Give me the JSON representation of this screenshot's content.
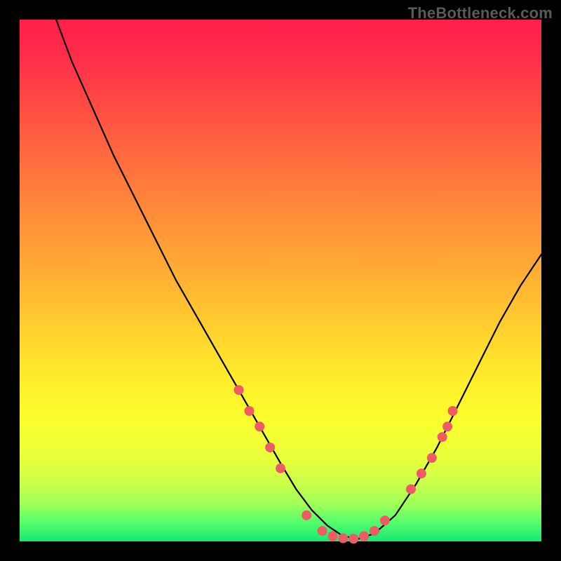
{
  "watermark": "TheBottleneck.com",
  "colors": {
    "background": "#000000",
    "curve": "#000000",
    "dots": "#ef5b63",
    "gradient_top": "#ff1f4b",
    "gradient_bottom": "#17e874"
  },
  "chart_data": {
    "type": "line",
    "title": "",
    "xlabel": "",
    "ylabel": "",
    "xlim": [
      0,
      100
    ],
    "ylim": [
      0,
      100
    ],
    "grid": false,
    "legend": false,
    "annotations": [],
    "series": [
      {
        "name": "curve",
        "x": [
          7,
          10,
          14,
          18,
          22,
          26,
          30,
          34,
          38,
          42,
          46,
          50,
          53,
          56,
          59,
          62,
          65,
          68,
          72,
          76,
          80,
          84,
          88,
          92,
          96,
          100
        ],
        "y": [
          100,
          92,
          83,
          74,
          66,
          58,
          50,
          43,
          36,
          29,
          22,
          15,
          10,
          6,
          3,
          1,
          0.5,
          1.5,
          5,
          11,
          18,
          26,
          34,
          42,
          49,
          55
        ]
      }
    ],
    "markers": [
      {
        "x": 42,
        "y": 29
      },
      {
        "x": 44,
        "y": 25
      },
      {
        "x": 46,
        "y": 22
      },
      {
        "x": 48,
        "y": 18
      },
      {
        "x": 50,
        "y": 14
      },
      {
        "x": 55,
        "y": 5
      },
      {
        "x": 58,
        "y": 2
      },
      {
        "x": 60,
        "y": 1
      },
      {
        "x": 62,
        "y": 0.6
      },
      {
        "x": 64,
        "y": 0.5
      },
      {
        "x": 66,
        "y": 1
      },
      {
        "x": 68,
        "y": 2
      },
      {
        "x": 70,
        "y": 4
      },
      {
        "x": 75,
        "y": 10
      },
      {
        "x": 77,
        "y": 13
      },
      {
        "x": 79,
        "y": 16
      },
      {
        "x": 81,
        "y": 20
      },
      {
        "x": 82,
        "y": 22
      },
      {
        "x": 83,
        "y": 25
      }
    ]
  }
}
